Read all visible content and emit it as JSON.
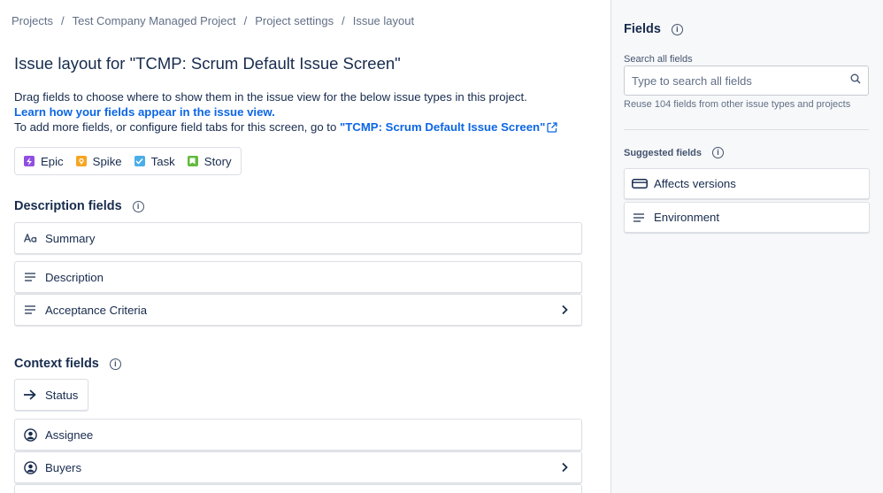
{
  "breadcrumb": [
    "Projects",
    "Test Company Managed Project",
    "Project settings",
    "Issue layout"
  ],
  "breadcrumb_separator": "/",
  "title": "Issue layout for \"TCMP: Scrum Default Issue Screen\"",
  "intro": {
    "line1": "Drag fields to choose where to show them in the issue view for the below issue types in this project.",
    "learn_link": "Learn how your fields appear in the issue view.",
    "line3_prefix": "To add more fields, or configure field tabs for this screen, go to ",
    "screen_link": "\"TCMP: Scrum Default Issue Screen\""
  },
  "issue_types": [
    {
      "label": "Epic",
      "icon": "epic-icon",
      "color": "#904ee2"
    },
    {
      "label": "Spike",
      "icon": "spike-icon",
      "color": "#f5a623"
    },
    {
      "label": "Task",
      "icon": "task-icon",
      "color": "#4bade8"
    },
    {
      "label": "Story",
      "icon": "story-icon",
      "color": "#63ba3c"
    }
  ],
  "description_section": {
    "heading": "Description fields",
    "fields": [
      {
        "label": "Summary",
        "icon": "text-aa-icon"
      },
      {
        "label": "Description",
        "icon": "paragraph-icon"
      },
      {
        "label": "Acceptance Criteria",
        "icon": "paragraph-icon",
        "expandable": true
      }
    ]
  },
  "context_section": {
    "heading": "Context fields",
    "status": {
      "label": "Status",
      "icon": "arrow-right-icon"
    },
    "fields": [
      {
        "label": "Assignee",
        "icon": "person-icon"
      },
      {
        "label": "Buyers",
        "icon": "person-icon",
        "expandable": true
      }
    ]
  },
  "sidebar": {
    "heading": "Fields",
    "search_label": "Search all fields",
    "search_placeholder": "Type to search all fields",
    "reuse_text": "Reuse 104 fields from other issue types and projects",
    "suggested_heading": "Suggested fields",
    "suggested": [
      {
        "label": "Affects versions",
        "icon": "version-icon"
      },
      {
        "label": "Environment",
        "icon": "paragraph-icon"
      }
    ]
  },
  "colors": {
    "link": "#0c66e4",
    "text": "#172b4d",
    "subtle": "#626f86",
    "border": "#dcdfe4"
  }
}
